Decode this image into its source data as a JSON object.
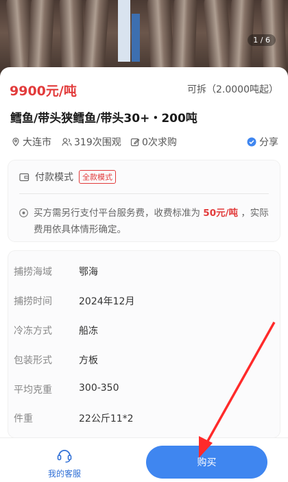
{
  "gallery": {
    "counter": "1 / 6"
  },
  "product": {
    "price": "9900元/吨",
    "split_info": "可拆（2.0000吨起）",
    "title": "鳕鱼/带头狭鳕鱼/带头30+・200吨",
    "location": "大连市",
    "views": "319次围观",
    "requests": "0次求购",
    "share_label": "分享"
  },
  "payment": {
    "label": "付款模式",
    "mode_badge": "全款模式",
    "note_prefix": "买方需另行支付平台服务费，收费标准为",
    "note_fee": "50元/吨",
    "note_suffix": "，实际费用依具体情形确定。"
  },
  "specs": [
    {
      "key": "捕捞海域",
      "value": "鄂海"
    },
    {
      "key": "捕捞时间",
      "value": "2024年12月"
    },
    {
      "key": "冷冻方式",
      "value": "船冻"
    },
    {
      "key": "包装形式",
      "value": "方板"
    },
    {
      "key": "平均克重",
      "value": "300-350"
    },
    {
      "key": "件重",
      "value": "22公斤11*2"
    }
  ],
  "bottom_bar": {
    "service_label": "我的客服",
    "buy_label": "购买"
  },
  "colors": {
    "price_red": "#e23b3b",
    "primary_blue": "#3f86f0"
  }
}
